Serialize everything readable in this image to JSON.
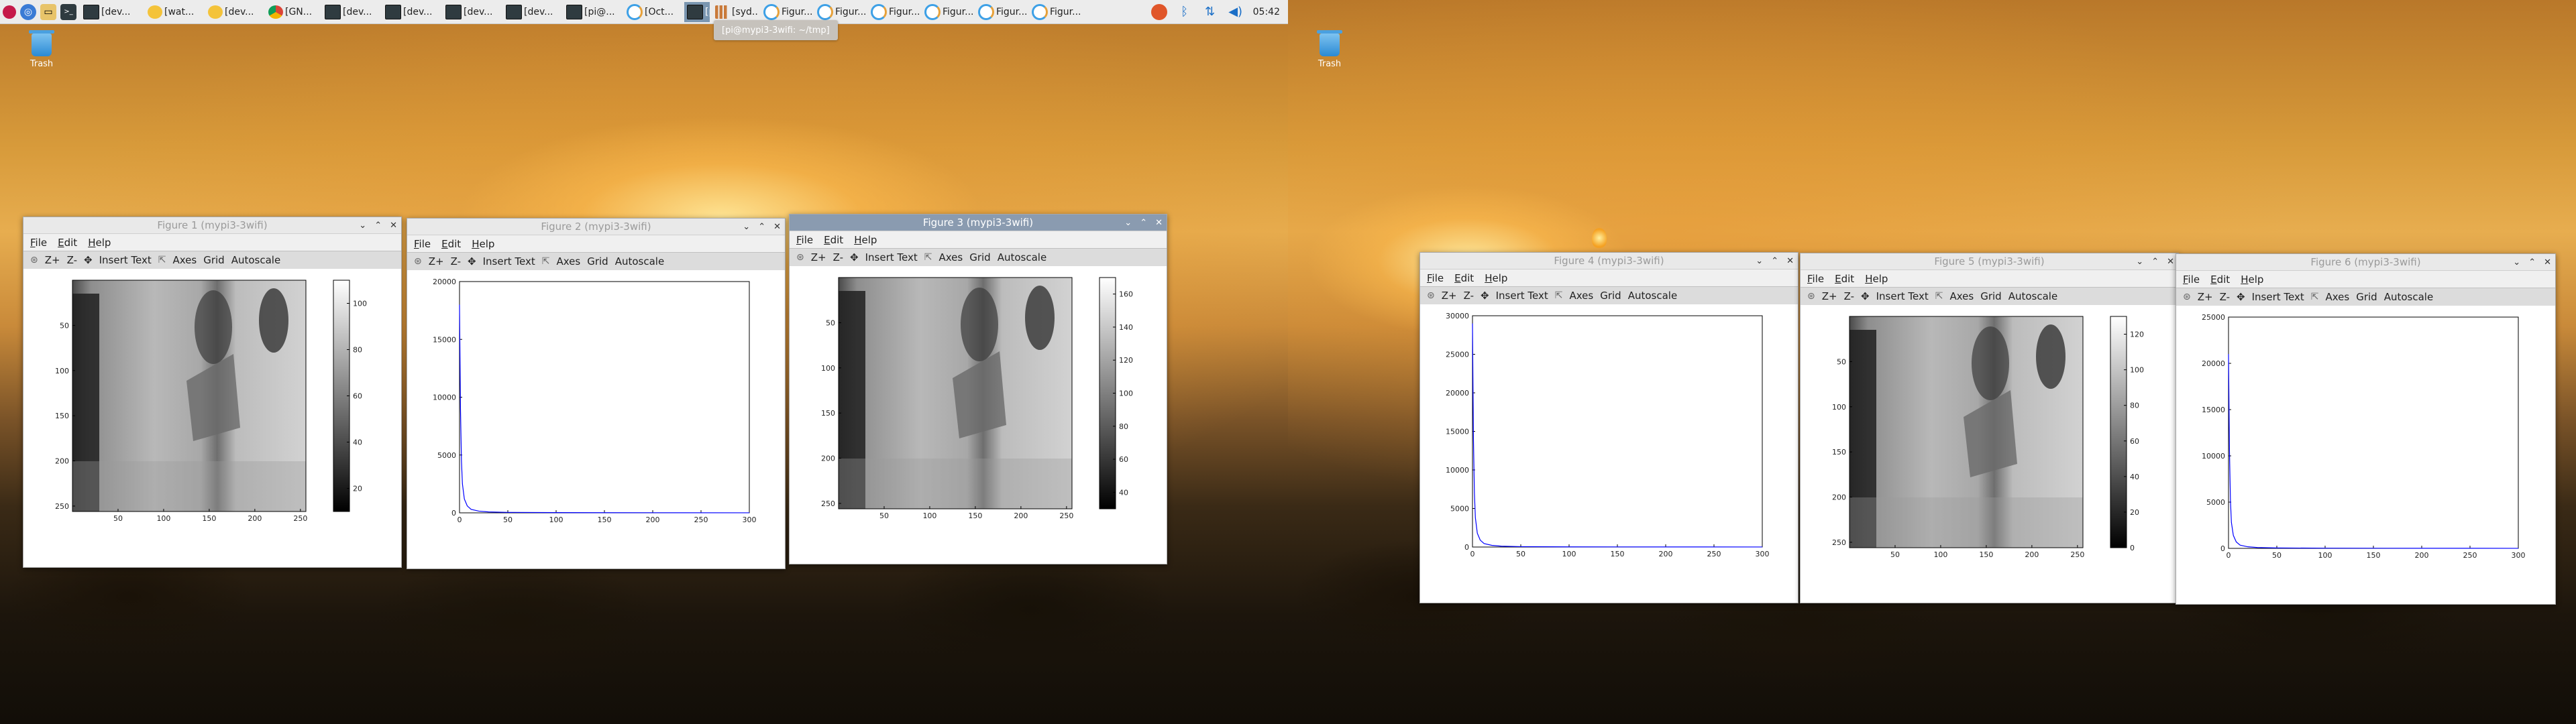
{
  "taskbar": {
    "buttons": [
      {
        "icon": "terminal",
        "label": "[dev..."
      },
      {
        "icon": "smile",
        "label": "[wat..."
      },
      {
        "icon": "gnome",
        "label": "[dev..."
      },
      {
        "icon": "chrome",
        "label": "[GN..."
      },
      {
        "icon": "terminal",
        "label": "[dev..."
      },
      {
        "icon": "terminal",
        "label": "[dev..."
      },
      {
        "icon": "terminal",
        "label": "[dev..."
      },
      {
        "icon": "terminal",
        "label": "[dev..."
      },
      {
        "icon": "terminal",
        "label": "[pi@..."
      },
      {
        "icon": "figure",
        "label": "[Oct..."
      },
      {
        "icon": "terminal",
        "label": "[pi@..."
      },
      {
        "icon": "bar",
        "label": "[syd..."
      },
      {
        "icon": "figure",
        "label": "Figur..."
      },
      {
        "icon": "figure",
        "label": "Figur..."
      },
      {
        "icon": "figure",
        "label": "Figur..."
      },
      {
        "icon": "figure",
        "label": "Figur..."
      },
      {
        "icon": "figure",
        "label": "Figur..."
      },
      {
        "icon": "figure",
        "label": "Figur..."
      }
    ],
    "active_index": 10,
    "clock": "05:42",
    "tooltip": "[pi@mypi3-3wifi: ~/tmp]"
  },
  "desktop": {
    "trash_label": "Trash"
  },
  "menus": [
    "File",
    "Edit",
    "Help"
  ],
  "toolbar_labels": {
    "zoom_in": "Z+",
    "zoom_out": "Z-",
    "insert_text": "Insert Text",
    "axes": "Axes",
    "grid": "Grid",
    "autoscale": "Autoscale"
  },
  "windows": [
    {
      "title": "Figure 1 (mypi3-3wifi)",
      "kind": "image",
      "active": false,
      "xticks": [
        "50",
        "100",
        "150",
        "200",
        "250"
      ],
      "yticks": [
        "50",
        "100",
        "150",
        "200",
        "250"
      ],
      "cbar_ticks": [
        "20",
        "40",
        "60",
        "80",
        "100"
      ]
    },
    {
      "title": "Figure 2 (mypi3-3wifi)",
      "kind": "line",
      "active": false,
      "xticks": [
        "0",
        "50",
        "100",
        "150",
        "200",
        "250",
        "300"
      ],
      "yticks": [
        "0",
        "5000",
        "10000",
        "15000",
        "20000"
      ]
    },
    {
      "title": "Figure 3 (mypi3-3wifi)",
      "kind": "image",
      "active": true,
      "xticks": [
        "50",
        "100",
        "150",
        "200",
        "250"
      ],
      "yticks": [
        "50",
        "100",
        "150",
        "200",
        "250"
      ],
      "cbar_ticks": [
        "40",
        "60",
        "80",
        "100",
        "120",
        "140",
        "160"
      ]
    },
    {
      "title": "Figure 4 (mypi3-3wifi)",
      "kind": "line",
      "active": false,
      "xticks": [
        "0",
        "50",
        "100",
        "150",
        "200",
        "250",
        "300"
      ],
      "yticks": [
        "0",
        "5000",
        "10000",
        "15000",
        "20000",
        "25000",
        "30000"
      ]
    },
    {
      "title": "Figure 5 (mypi3-3wifi)",
      "kind": "image",
      "active": false,
      "xticks": [
        "50",
        "100",
        "150",
        "200",
        "250"
      ],
      "yticks": [
        "50",
        "100",
        "150",
        "200",
        "250"
      ],
      "cbar_ticks": [
        "0",
        "20",
        "40",
        "60",
        "80",
        "100",
        "120"
      ]
    },
    {
      "title": "Figure 6 (mypi3-3wifi)",
      "kind": "line",
      "active": false,
      "xticks": [
        "0",
        "50",
        "100",
        "150",
        "200",
        "250",
        "300"
      ],
      "yticks": [
        "0",
        "5000",
        "10000",
        "15000",
        "20000",
        "25000"
      ]
    }
  ],
  "chart_data": [
    {
      "type": "heatmap",
      "xlim": [
        0,
        256
      ],
      "ylim": [
        256,
        0
      ],
      "colormap": "gray",
      "clim": [
        10,
        110
      ]
    },
    {
      "type": "line",
      "series": [
        {
          "color": "#0000ff",
          "x": [
            0,
            1,
            2,
            3,
            5,
            8,
            12,
            20,
            30,
            50,
            100,
            200,
            300
          ],
          "y": [
            18000,
            9000,
            4500,
            2500,
            1200,
            600,
            300,
            150,
            80,
            40,
            20,
            10,
            5
          ]
        }
      ],
      "xlim": [
        0,
        300
      ],
      "ylim": [
        0,
        20000
      ]
    },
    {
      "type": "heatmap",
      "xlim": [
        0,
        256
      ],
      "ylim": [
        256,
        0
      ],
      "colormap": "gray",
      "clim": [
        30,
        170
      ]
    },
    {
      "type": "line",
      "series": [
        {
          "color": "#0000ff",
          "x": [
            0,
            1,
            2,
            3,
            5,
            8,
            12,
            20,
            30,
            50,
            100,
            200,
            300
          ],
          "y": [
            29000,
            14000,
            7000,
            3800,
            1800,
            900,
            450,
            220,
            110,
            50,
            25,
            12,
            6
          ]
        }
      ],
      "xlim": [
        0,
        300
      ],
      "ylim": [
        0,
        30000
      ]
    },
    {
      "type": "heatmap",
      "xlim": [
        0,
        256
      ],
      "ylim": [
        256,
        0
      ],
      "colormap": "gray",
      "clim": [
        0,
        130
      ]
    },
    {
      "type": "line",
      "series": [
        {
          "color": "#0000ff",
          "x": [
            0,
            1,
            2,
            3,
            5,
            8,
            12,
            20,
            30,
            50,
            100,
            200,
            300
          ],
          "y": [
            21000,
            10500,
            5200,
            2800,
            1400,
            700,
            350,
            170,
            90,
            45,
            22,
            11,
            5
          ]
        }
      ],
      "xlim": [
        0,
        300
      ],
      "ylim": [
        0,
        25000
      ]
    }
  ]
}
